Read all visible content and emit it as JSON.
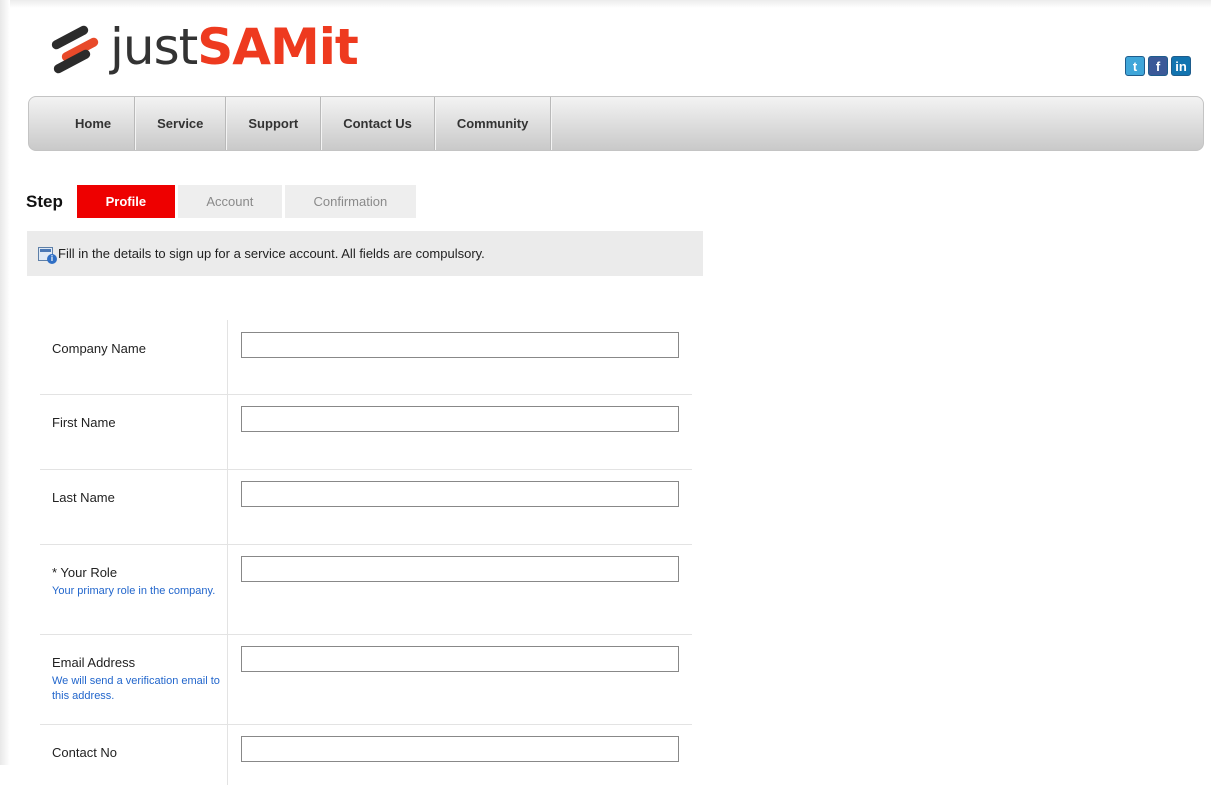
{
  "logo": {
    "text_part1": "just",
    "text_part2": "SAMit"
  },
  "social": [
    {
      "icon": "twitter-icon",
      "glyph": "t"
    },
    {
      "icon": "facebook-icon",
      "glyph": "f"
    },
    {
      "icon": "linkedin-icon",
      "glyph": "in"
    }
  ],
  "nav": [
    "Home",
    "Service",
    "Support",
    "Contact Us",
    "Community"
  ],
  "steps": {
    "label": "Step",
    "tabs": [
      "Profile",
      "Account",
      "Confirmation"
    ],
    "active": "Profile"
  },
  "info": {
    "icon": "info-icon",
    "text": "Fill in the details to sign up for a service account. All fields are compulsory."
  },
  "form": {
    "fields": [
      {
        "label": "Company Name",
        "hint": "",
        "value": ""
      },
      {
        "label": "First Name",
        "hint": "",
        "value": ""
      },
      {
        "label": "Last Name",
        "hint": "",
        "value": ""
      },
      {
        "label": "* Your Role",
        "hint": "Your primary role in the company.",
        "value": ""
      },
      {
        "label": "Email Address",
        "hint": "We will send a verification email to this address.",
        "value": ""
      },
      {
        "label": "Contact No",
        "hint": "",
        "value": ""
      }
    ]
  },
  "colors": {
    "accent": "#ee0000",
    "logo_red": "#ee3a1f",
    "hint_blue": "#2266cc"
  }
}
